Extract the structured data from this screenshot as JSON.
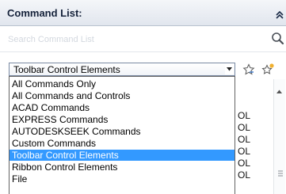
{
  "header": {
    "title": "Command List:"
  },
  "search": {
    "placeholder": "Search Command List"
  },
  "filter": {
    "selected": "Toolbar Control Elements",
    "options": [
      "All Commands Only",
      "All Commands and Controls",
      "ACAD Commands",
      "EXPRESS Commands",
      "AUTODESKSEEK Commands",
      "Custom Commands",
      "Toolbar Control Elements",
      "Ribbon Control Elements",
      "File"
    ]
  },
  "right_list": {
    "cells": [
      "OL",
      "OL",
      "OL",
      "OL",
      "OL",
      "OL"
    ]
  },
  "colors": {
    "selection": "#3399ff",
    "header_text": "#15223a"
  }
}
